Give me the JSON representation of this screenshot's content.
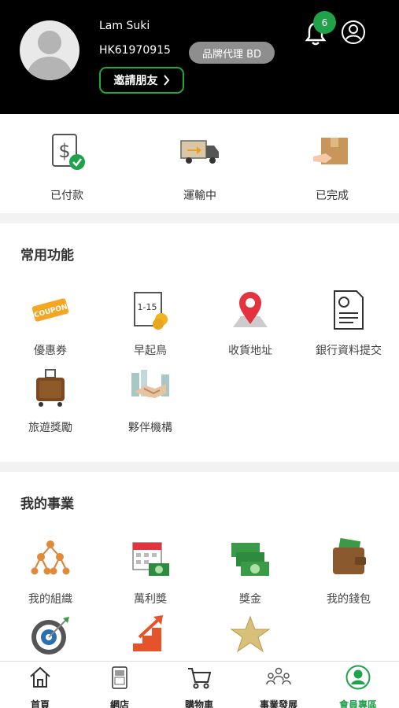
{
  "header": {
    "user_name": "Lam Suki",
    "member_id": "HK61970915",
    "rank": "品牌代理 BD",
    "invite_label": "邀請朋友",
    "notification_count": "6"
  },
  "orders": [
    {
      "label": "已付款",
      "icon": "paid-dollar-icon"
    },
    {
      "label": "運輸中",
      "icon": "delivery-truck-icon"
    },
    {
      "label": "已完成",
      "icon": "completed-box-icon"
    }
  ],
  "common": {
    "title": "常用功能",
    "items": [
      {
        "label": "優惠券",
        "icon": "coupon-icon"
      },
      {
        "label": "早起鳥",
        "icon": "early-bird-calendar-icon"
      },
      {
        "label": "收貨地址",
        "icon": "location-pin-icon"
      },
      {
        "label": "銀行資料提交",
        "icon": "bank-document-icon"
      },
      {
        "label": "旅遊獎勵",
        "icon": "luggage-icon"
      },
      {
        "label": "夥伴機構",
        "icon": "handshake-icon"
      }
    ]
  },
  "business": {
    "title": "我的事業",
    "items": [
      {
        "label": "我的組織",
        "icon": "organization-tree-icon"
      },
      {
        "label": "萬利獎",
        "icon": "calendar-cash-icon"
      },
      {
        "label": "獎金",
        "icon": "cash-stack-icon"
      },
      {
        "label": "我的錢包",
        "icon": "wallet-icon"
      },
      {
        "label": "",
        "icon": "target-icon"
      },
      {
        "label": "",
        "icon": "growth-stairs-icon"
      },
      {
        "label": "",
        "icon": "gold-star-icon"
      }
    ]
  },
  "bottom_nav": [
    {
      "label": "首頁",
      "icon": "home-icon"
    },
    {
      "label": "網店",
      "icon": "shop-icon"
    },
    {
      "label": "購物車",
      "icon": "cart-icon"
    },
    {
      "label": "事業發展",
      "icon": "team-icon"
    },
    {
      "label": "會員專區",
      "icon": "member-icon"
    }
  ],
  "colors": {
    "accent": "#1fa24a",
    "header_bg": "#000000",
    "badge_gray": "#8e8e8e"
  }
}
